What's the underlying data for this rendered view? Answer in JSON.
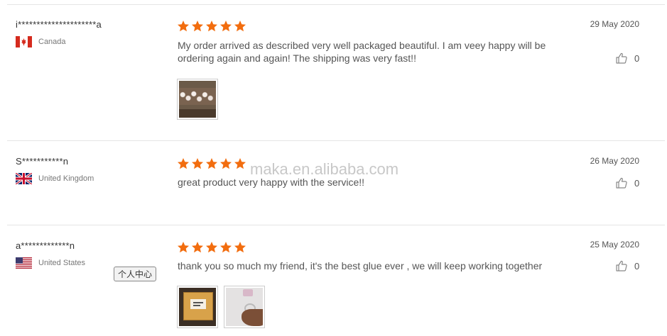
{
  "accent_color": "#f26d0f",
  "watermark": "maka.en.alibaba.com",
  "tooltip_label": "个人中心",
  "reviews": [
    {
      "reviewer": "i*********************a",
      "country": "Canada",
      "flag": "canada-flag",
      "rating": 5,
      "date": "29 May 2020",
      "text": "My order arrived as described very well packaged beautiful. I am veey happy will be ordering again and again! The shipping was very fast!!",
      "likes": "0",
      "photos": [
        "eggs-photo"
      ]
    },
    {
      "reviewer": "S***********n",
      "country": "United Kingdom",
      "flag": "uk-flag",
      "rating": 5,
      "date": "26 May 2020",
      "text": "great product very happy with the service!!",
      "likes": "0",
      "photos": []
    },
    {
      "reviewer": "a*************n",
      "country": "United States",
      "flag": "us-flag",
      "rating": 5,
      "date": "25 May 2020",
      "text": "thank you so much my friend, it's the best glue ever , we will keep working together",
      "likes": "0",
      "photos": [
        "box-photo",
        "hand-photo"
      ]
    }
  ]
}
